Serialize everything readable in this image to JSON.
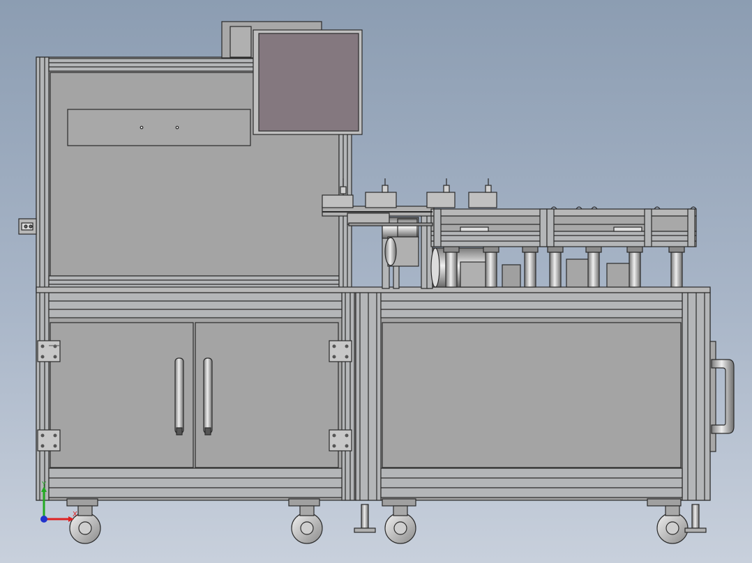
{
  "scene": {
    "background_top": "#8c9db2",
    "background_bottom": "#c8d0dc",
    "body_color": "#a4a4a4",
    "frame_color": "#b4b6b8",
    "edge_color": "#2a2a2a",
    "screen_color": "#84787f"
  },
  "triad": {
    "y_label": "Y",
    "x_label": "X",
    "y_color": "#22aa22",
    "x_color": "#dd2222",
    "z_color": "#2233cc"
  }
}
